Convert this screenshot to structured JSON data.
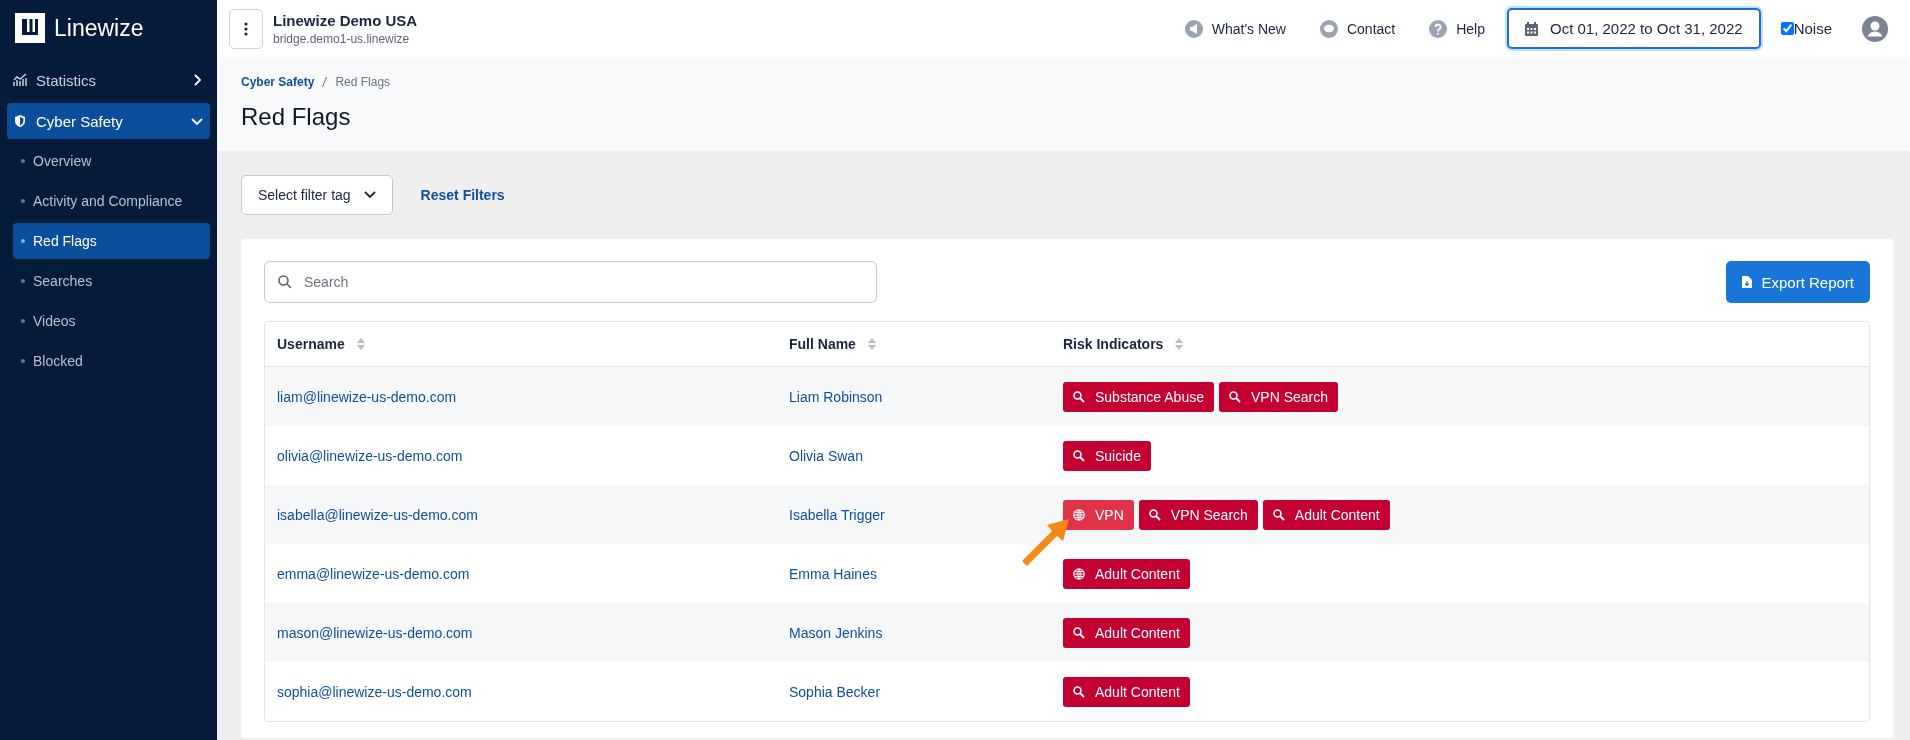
{
  "sidebar": {
    "logo": "Linewize",
    "items": [
      {
        "label": "Statistics",
        "kind": "chart",
        "expanded": false,
        "selected": false
      },
      {
        "label": "Cyber Safety",
        "kind": "shield",
        "expanded": true,
        "selected": true,
        "children": [
          {
            "label": "Overview",
            "selected": false
          },
          {
            "label": "Activity and Compliance",
            "selected": false
          },
          {
            "label": "Red Flags",
            "selected": true
          },
          {
            "label": "Searches",
            "selected": false
          },
          {
            "label": "Videos",
            "selected": false
          },
          {
            "label": "Blocked",
            "selected": false
          }
        ]
      }
    ]
  },
  "header": {
    "org_name": "Linewize Demo USA",
    "org_host": "bridge.demo1-us.linewize",
    "links": [
      {
        "label": "What's New",
        "kind": "megaphone"
      },
      {
        "label": "Contact",
        "kind": "chat"
      },
      {
        "label": "Help",
        "kind": "help"
      }
    ],
    "date_range": "Oct 01, 2022 to Oct 31, 2022",
    "noise": {
      "label": "Noise",
      "checked": true
    }
  },
  "breadcrumb": [
    {
      "label": "Cyber Safety",
      "current": false
    },
    {
      "label": "Red Flags",
      "current": true
    }
  ],
  "page_title": "Red Flags",
  "filters": {
    "select_label": "Select filter tag",
    "reset_label": "Reset Filters"
  },
  "search": {
    "placeholder": "Search"
  },
  "export_button": "Export Report",
  "table": {
    "columns": [
      "Username",
      "Full Name",
      "Risk Indicators"
    ],
    "rows": [
      {
        "username": "liam@linewize-us-demo.com",
        "full_name": "Liam Robinson",
        "indicators": [
          {
            "label": "Substance Abuse",
            "kind": "search",
            "highlighted": false
          },
          {
            "label": "VPN Search",
            "kind": "search",
            "highlighted": false
          }
        ]
      },
      {
        "username": "olivia@linewize-us-demo.com",
        "full_name": "Olivia Swan",
        "indicators": [
          {
            "label": "Suicide",
            "kind": "search",
            "highlighted": false
          }
        ]
      },
      {
        "username": "isabella@linewize-us-demo.com",
        "full_name": "Isabella Trigger",
        "indicators": [
          {
            "label": "VPN",
            "kind": "web",
            "highlighted": true
          },
          {
            "label": "VPN Search",
            "kind": "search",
            "highlighted": false
          },
          {
            "label": "Adult Content",
            "kind": "search",
            "highlighted": false
          }
        ]
      },
      {
        "username": "emma@linewize-us-demo.com",
        "full_name": "Emma Haines",
        "indicators": [
          {
            "label": "Adult Content",
            "kind": "web",
            "highlighted": false
          }
        ]
      },
      {
        "username": "mason@linewize-us-demo.com",
        "full_name": "Mason Jenkins",
        "indicators": [
          {
            "label": "Adult Content",
            "kind": "search",
            "highlighted": false
          }
        ]
      },
      {
        "username": "sophia@linewize-us-demo.com",
        "full_name": "Sophia Becker",
        "indicators": [
          {
            "label": "Adult Content",
            "kind": "search",
            "highlighted": false
          }
        ]
      }
    ]
  }
}
